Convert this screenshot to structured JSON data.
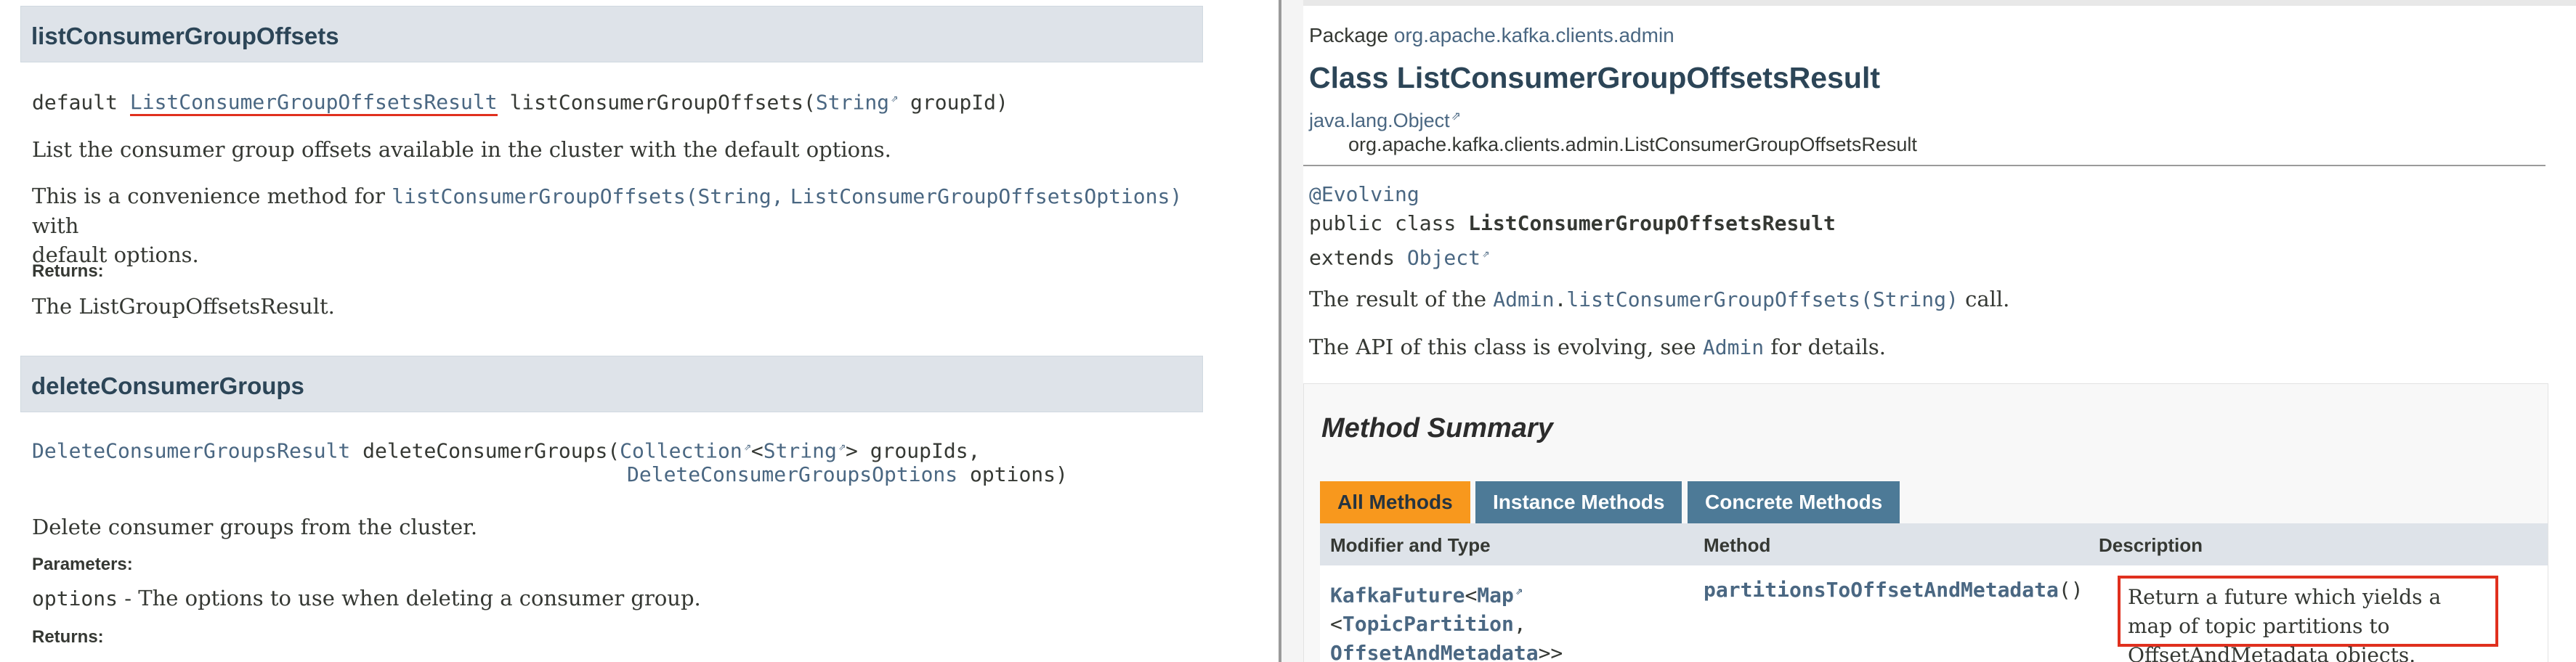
{
  "left": {
    "section1": {
      "title": "listConsumerGroupOffsets",
      "sig_prefix": "default ",
      "sig_return": "ListConsumerGroupOffsetsResult",
      "sig_method": " listConsumerGroupOffsets(",
      "sig_param_type": "String",
      "sig_param": " groupId)",
      "desc": "List the consumer group offsets available in the cluster with the default options.",
      "conv_prefix": "This is a convenience method for ",
      "conv_link1": "listConsumerGroupOffsets(String,",
      "conv_link2": "ListConsumerGroupOffsetsOptions)",
      "conv_suffix": " with",
      "conv_line2": "default options.",
      "returns_label": "Returns:",
      "returns_text": "The ListGroupOffsetsResult."
    },
    "section2": {
      "title": "deleteConsumerGroups",
      "sig_return": "DeleteConsumerGroupsResult",
      "sig_method": " deleteConsumerGroups(",
      "sig_coll": "Collection",
      "sig_lt": "<",
      "sig_string": "String",
      "sig_rest": "> groupIds,",
      "sig_opts_type": "DeleteConsumerGroupsOptions",
      "sig_opts": " options)",
      "desc": "Delete consumer groups from the cluster.",
      "params_label": "Parameters:",
      "param_name": "options",
      "param_desc": " - The options to use when deleting a consumer group.",
      "returns_label": "Returns:"
    }
  },
  "right": {
    "package_label": "Package ",
    "package_name": "org.apache.kafka.clients.admin",
    "class_title": "Class ListConsumerGroupOffsetsResult",
    "hier_parent": "java.lang.Object",
    "hier_child": "org.apache.kafka.clients.admin.ListConsumerGroupOffsetsResult",
    "annotation": "@Evolving",
    "decl_prefix": "public class ",
    "decl_name": "ListConsumerGroupOffsetsResult",
    "extends_kw": "extends ",
    "extends_name": "Object",
    "result_prefix": "The result of the ",
    "result_link_a": "Admin",
    "result_dot": ".",
    "result_link_b": "listConsumerGroupOffsets(String)",
    "result_suffix": " call.",
    "api_prefix": "The API of this class is evolving, see ",
    "api_link": "Admin",
    "api_suffix": " for details.",
    "summary_title": "Method Summary",
    "tabs": [
      "All Methods",
      "Instance Methods",
      "Concrete Methods"
    ],
    "columns": [
      "Modifier and Type",
      "Method",
      "Description"
    ],
    "row": {
      "type_a": "KafkaFuture",
      "type_b": "Map",
      "type_c": "TopicPartition",
      "type_d": "OffsetAndMetadata",
      "method": "partitionsToOffsetAndMetadata",
      "method_parens": "()",
      "desc": "Return a future which yields a map of topic partitions to OffsetAndMetadata objects."
    }
  },
  "colors": {
    "link": "#4a6782",
    "header_bg": "#dee3e9",
    "tab_active": "#f8981d",
    "tab_inactive": "#4d7a97",
    "highlight": "#e0301e"
  },
  "icons": [
    "external-link-icon"
  ]
}
